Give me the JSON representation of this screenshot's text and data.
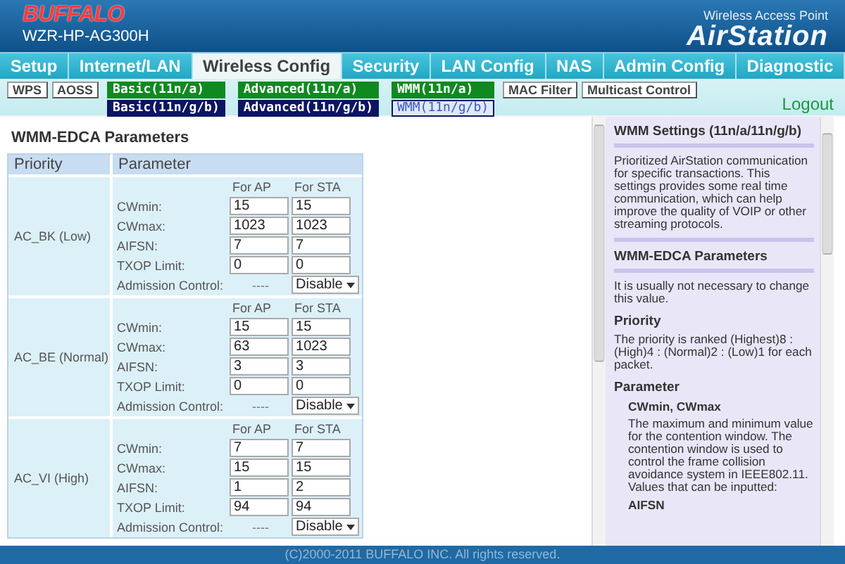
{
  "header": {
    "logo": "BUFFALO",
    "model": "WZR-HP-AG300H",
    "product_line": "Wireless Access Point",
    "product": "AirStation"
  },
  "tabs": [
    {
      "label": "Setup",
      "selected": false
    },
    {
      "label": "Internet/LAN",
      "selected": false
    },
    {
      "label": "Wireless Config",
      "selected": true
    },
    {
      "label": "Security",
      "selected": false
    },
    {
      "label": "LAN Config",
      "selected": false
    },
    {
      "label": "NAS",
      "selected": false
    },
    {
      "label": "Admin Config",
      "selected": false
    },
    {
      "label": "Diagnostic",
      "selected": false
    }
  ],
  "subnav": [
    {
      "kind": "button",
      "label": "WPS"
    },
    {
      "kind": "button",
      "label": "AOSS"
    },
    {
      "kind": "pair",
      "items": [
        {
          "label": "Basic(11n/a)",
          "color": "#108a20",
          "selected": false
        },
        {
          "label": "Basic(11n/g/b)",
          "color": "#0c1464",
          "selected": false
        }
      ]
    },
    {
      "kind": "pair",
      "items": [
        {
          "label": "Advanced(11n/a)",
          "color": "#108a20",
          "selected": false
        },
        {
          "label": "Advanced(11n/g/b)",
          "color": "#0c1464",
          "selected": false
        }
      ]
    },
    {
      "kind": "pair",
      "items": [
        {
          "label": "WMM(11n/a)",
          "color": "#108a20",
          "selected": false
        },
        {
          "label": "WMM(11n/g/b)",
          "color": "#0c1464",
          "selected": true
        }
      ]
    },
    {
      "kind": "button",
      "label": "MAC Filter"
    },
    {
      "kind": "button",
      "label": "Multicast Control"
    }
  ],
  "logout": "Logout",
  "section_title": "WMM-EDCA Parameters",
  "table": {
    "columns": [
      "Priority",
      "Parameter"
    ],
    "groups": [
      {
        "priority": "AC_BK (Low)",
        "headers": [
          "For AP",
          "For STA"
        ],
        "rows": [
          {
            "kind": "input",
            "label": "CWmin:",
            "ap": "15",
            "sta": "15"
          },
          {
            "kind": "input",
            "label": "CWmax:",
            "ap": "1023",
            "sta": "1023"
          },
          {
            "kind": "input",
            "label": "AIFSN:",
            "ap": "7",
            "sta": "7"
          },
          {
            "kind": "input",
            "label": "TXOP Limit:",
            "ap": "0",
            "sta": "0"
          },
          {
            "kind": "select",
            "label": "Admission Control:",
            "ap": "----",
            "sta": "Disable"
          }
        ]
      },
      {
        "priority": "AC_BE (Normal)",
        "headers": [
          "For AP",
          "For STA"
        ],
        "rows": [
          {
            "kind": "input",
            "label": "CWmin:",
            "ap": "15",
            "sta": "15"
          },
          {
            "kind": "input",
            "label": "CWmax:",
            "ap": "63",
            "sta": "1023"
          },
          {
            "kind": "input",
            "label": "AIFSN:",
            "ap": "3",
            "sta": "3"
          },
          {
            "kind": "input",
            "label": "TXOP Limit:",
            "ap": "0",
            "sta": "0"
          },
          {
            "kind": "select",
            "label": "Admission Control:",
            "ap": "----",
            "sta": "Disable"
          }
        ]
      },
      {
        "priority": "AC_VI (High)",
        "headers": [
          "For AP",
          "For STA"
        ],
        "rows": [
          {
            "kind": "input",
            "label": "CWmin:",
            "ap": "7",
            "sta": "7"
          },
          {
            "kind": "input",
            "label": "CWmax:",
            "ap": "15",
            "sta": "15"
          },
          {
            "kind": "input",
            "label": "AIFSN:",
            "ap": "1",
            "sta": "2"
          },
          {
            "kind": "input",
            "label": "TXOP Limit:",
            "ap": "94",
            "sta": "94"
          },
          {
            "kind": "select",
            "label": "Admission Control:",
            "ap": "----",
            "sta": "Disable"
          }
        ]
      }
    ]
  },
  "help": [
    {
      "kind": "title",
      "text": "WMM Settings (11n/a/11n/g/b)"
    },
    {
      "kind": "text",
      "text": "Prioritized AirStation communication for specific transactions. This settings provides some real time communication, which can help improve the quality of VOIP or other streaming protocols."
    },
    {
      "kind": "title",
      "text": "WMM-EDCA Parameters"
    },
    {
      "kind": "text",
      "text": "It is usually not necessary to change this value."
    },
    {
      "kind": "heading",
      "text": "Priority"
    },
    {
      "kind": "text",
      "text": "The priority is ranked (Highest)8 : (High)4 : (Normal)2 : (Low)1 for each packet."
    },
    {
      "kind": "heading",
      "text": "Parameter"
    },
    {
      "kind": "subheading",
      "text": "CWmin, CWmax"
    },
    {
      "kind": "subtext",
      "text": "The maximum and minimum value for the contention window. The contention window is used to control the frame collision avoidance system in IEEE802.11. Values that can be inputted:"
    },
    {
      "kind": "subheading",
      "text": "AIFSN"
    }
  ],
  "footer": "(C)2000-2011 BUFFALO INC. All rights reserved."
}
